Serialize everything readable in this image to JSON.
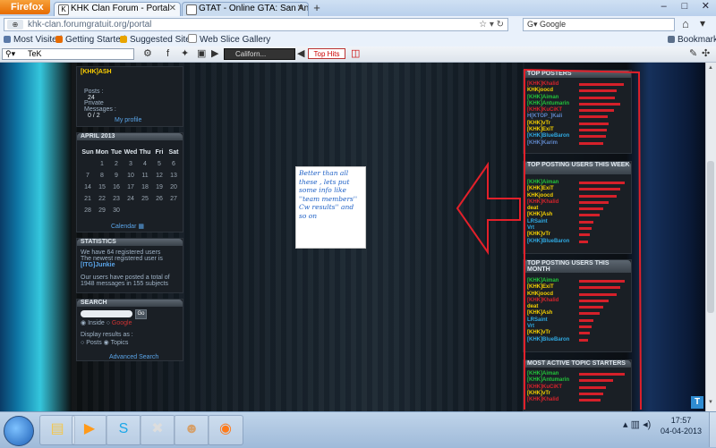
{
  "browser": {
    "app_button": "Firefox",
    "tabs": [
      {
        "label": "KHK Clan Forum - Portal",
        "active": true
      },
      {
        "label": "GTAT - Online GTA: San Andr...",
        "active": false
      }
    ],
    "new_tab": "+",
    "url": "khk-clan.forumgratuit.org/portal",
    "search_engine": "Google",
    "bookmarks": [
      "Most Visited",
      "Getting Started",
      "Suggested Sites",
      "Web Slice Gallery"
    ],
    "bookmarks_menu": "Bookmarks",
    "toolbar_search_value": "TeK",
    "radio_station": "Californ...",
    "top_hits": "Top Hits"
  },
  "left_sidebar": {
    "profile": {
      "username": "[KHK]ASH",
      "posts_label": "Posts :",
      "posts_value": "24",
      "private_messages_label": "Private Messages :",
      "private_messages_value": "0 / 2",
      "my_profile": "My profile"
    },
    "calendar": {
      "title": "APRIL 2013",
      "weekdays": [
        "Sun",
        "Mon",
        "Tue",
        "Wed",
        "Thu",
        "Fri",
        "Sat"
      ],
      "days": [
        "",
        "1",
        "2",
        "3",
        "4",
        "5",
        "6",
        "7",
        "8",
        "9",
        "10",
        "11",
        "12",
        "13",
        "14",
        "15",
        "16",
        "17",
        "18",
        "19",
        "20",
        "21",
        "22",
        "23",
        "24",
        "25",
        "26",
        "27",
        "28",
        "29",
        "30",
        "",
        "",
        "",
        ""
      ],
      "link": "Calendar"
    },
    "statistics": {
      "title": "STATISTICS",
      "line1": "We have 64 registered users",
      "line2": "The newest registered user is",
      "newest_user": "[ITG]Junkie",
      "line3": "Our users have posted a total of",
      "line4": "1948 messages in 155 subjects"
    },
    "search": {
      "title": "SEARCH",
      "go_button": "Go",
      "scope_inside": "Inside",
      "scope_google": "Google",
      "display_label": "Display results as :",
      "opt_posts": "Posts",
      "opt_topics": "Topics",
      "advanced": "Advanced Search"
    }
  },
  "annotation_note": "Better than all these , lets put some info like ''team members'' Cw results'' and so on",
  "right_sidebar": {
    "top_posters": {
      "title": "TOP POSTERS",
      "rows": [
        {
          "name": "[KHK]Khalid",
          "color": "#d4232b",
          "bar": 0.92
        },
        {
          "name": "KHKjoocd",
          "color": "#f5d000",
          "bar": 0.78
        },
        {
          "name": "[KHK]Aiman",
          "color": "#22c23a",
          "bar": 0.74
        },
        {
          "name": "[KHK]Antumarin",
          "color": "#22c23a",
          "bar": 0.86
        },
        {
          "name": "[KHK]KuCiKT",
          "color": "#d4232b",
          "bar": 0.72
        },
        {
          "name": "H[KTOP_]Kali",
          "color": "#5f86c8",
          "bar": 0.6
        },
        {
          "name": "[KHK]vTr",
          "color": "#f5d000",
          "bar": 0.62
        },
        {
          "name": "[KHK]ExiT",
          "color": "#f5d000",
          "bar": 0.58
        },
        {
          "name": "[KHK]BlueBaron",
          "color": "#2fa8e0",
          "bar": 0.55
        },
        {
          "name": "[KHK]Karim",
          "color": "#5f86c8",
          "bar": 0.5
        }
      ]
    },
    "top_posting_week": {
      "title": "TOP POSTING USERS THIS WEEK",
      "rows": [
        {
          "name": "[KHK]Aiman",
          "color": "#22c23a",
          "bar": 0.95
        },
        {
          "name": "[KHK]ExiT",
          "color": "#f5d000",
          "bar": 0.85
        },
        {
          "name": "KHKjoocd",
          "color": "#f5d000",
          "bar": 0.78
        },
        {
          "name": "[KHK]Khalid",
          "color": "#d4232b",
          "bar": 0.62
        },
        {
          "name": "deat",
          "color": "#f5d000",
          "bar": 0.5
        },
        {
          "name": "[KHK]Ash",
          "color": "#f5d000",
          "bar": 0.42
        },
        {
          "name": "LRSaint",
          "color": "#2fa8e0",
          "bar": 0.3
        },
        {
          "name": "Vrt",
          "color": "#2fa8e0",
          "bar": 0.25
        },
        {
          "name": "[KHK]vTr",
          "color": "#f5d000",
          "bar": 0.22
        },
        {
          "name": "[KHK]BlueBaron",
          "color": "#2fa8e0",
          "bar": 0.18
        }
      ]
    },
    "top_posting_month": {
      "title": "TOP POSTING USERS THIS MONTH",
      "rows": [
        {
          "name": "[KHK]Aiman",
          "color": "#22c23a",
          "bar": 0.95
        },
        {
          "name": "[KHK]ExiT",
          "color": "#f5d000",
          "bar": 0.85
        },
        {
          "name": "KHKjoocd",
          "color": "#f5d000",
          "bar": 0.78
        },
        {
          "name": "[KHK]Khalid",
          "color": "#d4232b",
          "bar": 0.62
        },
        {
          "name": "deat",
          "color": "#f5d000",
          "bar": 0.5
        },
        {
          "name": "[KHK]Ash",
          "color": "#f5d000",
          "bar": 0.42
        },
        {
          "name": "LRSaint",
          "color": "#2fa8e0",
          "bar": 0.3
        },
        {
          "name": "Vrt",
          "color": "#2fa8e0",
          "bar": 0.25
        },
        {
          "name": "[KHK]vTr",
          "color": "#f5d000",
          "bar": 0.22
        },
        {
          "name": "[KHK]BlueBaron",
          "color": "#2fa8e0",
          "bar": 0.18
        }
      ]
    },
    "most_active_topic_starters": {
      "title": "MOST ACTIVE TOPIC STARTERS",
      "rows": [
        {
          "name": "[KHK]Aiman",
          "color": "#22c23a",
          "bar": 0.95
        },
        {
          "name": "[KHK]Antumarin",
          "color": "#22c23a",
          "bar": 0.7
        },
        {
          "name": "[KHK]KuCiKT",
          "color": "#d4232b",
          "bar": 0.55
        },
        {
          "name": "[KHK]vTr",
          "color": "#f5d000",
          "bar": 0.5
        },
        {
          "name": "[KHK]Khalid",
          "color": "#d4232b",
          "bar": 0.45
        }
      ]
    }
  },
  "taskbar": {
    "apps": [
      "folder",
      "media-player",
      "skype",
      "game-launcher",
      "avatar-app",
      "firefox"
    ],
    "time": "17:57",
    "date": "04-04-2013"
  },
  "colors": {
    "annotation_red": "#e2202a",
    "accent_blue": "#2f8cd2"
  }
}
